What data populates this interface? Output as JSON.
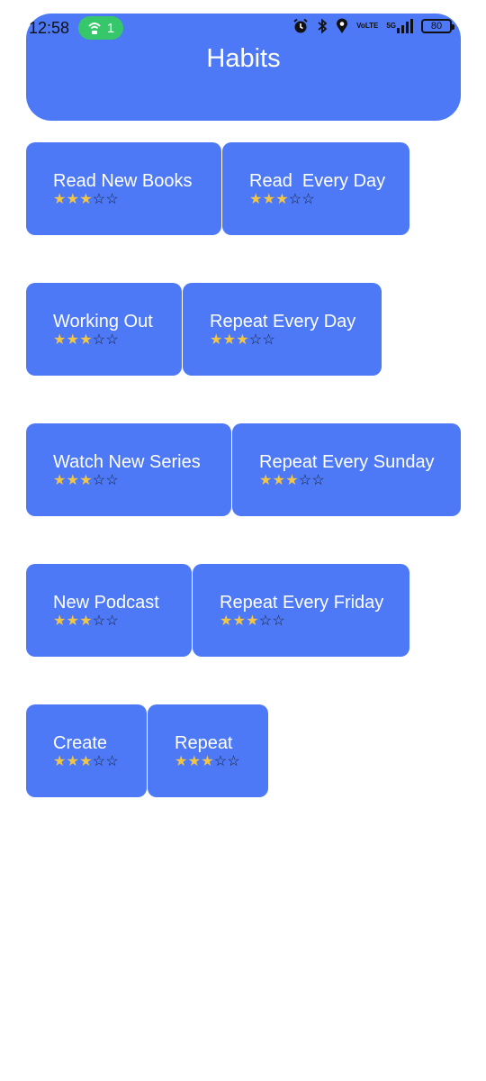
{
  "status_bar": {
    "time": "12:58",
    "hotspot_count": "1",
    "network_label_top": "Vo",
    "network_label_bottom": "LTE",
    "signal_label": "5G",
    "battery_level": "80"
  },
  "header": {
    "title": "Habits"
  },
  "rating": {
    "filled": 3,
    "max": 5,
    "filled_color": "#f4c542"
  },
  "accent_color": "#4d79f7",
  "rows": [
    {
      "habit": "Read New Books",
      "frequency": "Read  Every Day"
    },
    {
      "habit": "Working Out",
      "frequency": "Repeat Every Day"
    },
    {
      "habit": "Watch New Series",
      "frequency": "Repeat Every Sunday"
    },
    {
      "habit": "New Podcast",
      "frequency": "Repeat Every Friday"
    },
    {
      "habit": "Create",
      "frequency": "Repeat"
    }
  ]
}
